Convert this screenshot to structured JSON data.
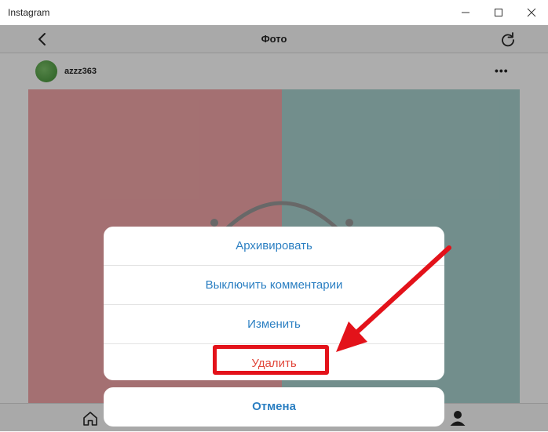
{
  "window": {
    "title": "Instagram",
    "controls": [
      "minimize-icon",
      "maximize-icon",
      "close-icon"
    ]
  },
  "header": {
    "title": "Фото",
    "back_icon": "back-arrow-icon",
    "refresh_icon": "refresh-icon"
  },
  "post": {
    "username": "azzz363",
    "more_label": "•••"
  },
  "action_sheet": {
    "items": [
      {
        "label": "Архивировать"
      },
      {
        "label": "Выключить комментарии"
      },
      {
        "label": "Изменить"
      },
      {
        "label": "Удалить"
      }
    ],
    "cancel_label": "Отмена"
  },
  "bottom_nav": {
    "home_icon": "home-icon",
    "profile_icon": "profile-icon"
  },
  "colors": {
    "accent_blue": "#2b7fc2",
    "danger_red": "#e1473b",
    "annotation_red": "#e3121a"
  }
}
